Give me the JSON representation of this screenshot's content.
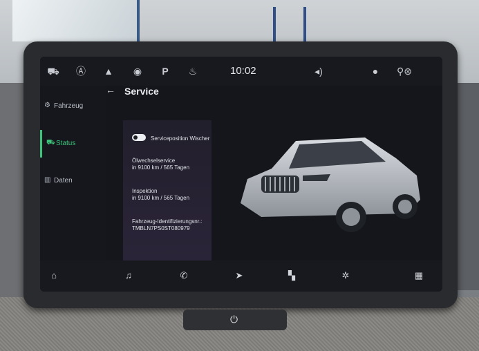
{
  "statusbar": {
    "icons": [
      "car-icon",
      "assist-icon",
      "terrain-icon",
      "camera-car-icon",
      "parking-icon",
      "heat-icon"
    ],
    "clock": "10:02",
    "right_icons": [
      "volume-icon",
      "user-icon",
      "profile-location-icon"
    ]
  },
  "sidebar": {
    "items": [
      {
        "label": "Fahrzeug",
        "icon": "car-settings-icon",
        "active": false
      },
      {
        "label": "Status",
        "icon": "car-status-icon",
        "active": true
      },
      {
        "label": "Daten",
        "icon": "data-icon",
        "active": false
      }
    ]
  },
  "page": {
    "title": "Service",
    "back_icon": "back-arrow-icon"
  },
  "settings": {
    "toggle_label": "Serviceposition Wischer",
    "oil_title": "Ölwechselservice",
    "oil_value": "in 9100 km / 565 Tagen",
    "insp_title": "Inspektion",
    "insp_value": "in 9100 km / 565 Tagen",
    "vin_title": "Fahrzeug-Identifizierungsnr.:",
    "vin_value": "TMBLN7PS0ST080979"
  },
  "navbar": {
    "icons": [
      "home-icon",
      "music-icon",
      "phone-icon",
      "navigation-icon",
      "apps-icon",
      "climate-icon",
      "grid-menu-icon"
    ]
  },
  "colors": {
    "accent": "#3cc47b",
    "background": "#14161b"
  }
}
